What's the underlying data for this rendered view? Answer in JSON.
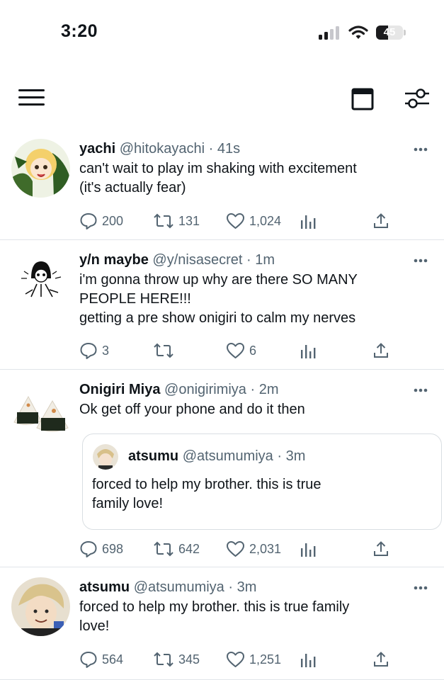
{
  "status_bar": {
    "time": "3:20",
    "battery": "45"
  },
  "tweets": [
    {
      "name": "yachi",
      "handle": "@hitokayachi",
      "time": "41s",
      "lines": [
        "can't wait to play im shaking with excitement",
        "(it's actually fear)"
      ],
      "replies": "200",
      "retweets": "131",
      "likes": "1,024"
    },
    {
      "name": "y/n maybe",
      "handle": "@y/nisasecret",
      "time": "1m",
      "lines": [
        "i'm gonna throw up why are there SO MANY",
        "PEOPLE HERE!!!",
        "getting a pre show onigiri to calm my nerves"
      ],
      "replies": "3",
      "retweets": "",
      "likes": "6"
    },
    {
      "name": "Onigiri Miya",
      "handle": "@onigirimiya",
      "time": "2m",
      "lines": [
        "Ok get off your phone and do it then"
      ],
      "quote": {
        "name": "atsumu",
        "handle": "@atsumumiya",
        "time": "3m",
        "lines": [
          "forced to help my brother. this is true",
          "family love!"
        ]
      },
      "replies": "698",
      "retweets": "642",
      "likes": "2,031"
    },
    {
      "name": "atsumu",
      "handle": "@atsumumiya",
      "time": "3m",
      "lines": [
        "forced to help my brother. this is true family",
        "love!"
      ],
      "replies": "564",
      "retweets": "345",
      "likes": "1,251"
    }
  ]
}
